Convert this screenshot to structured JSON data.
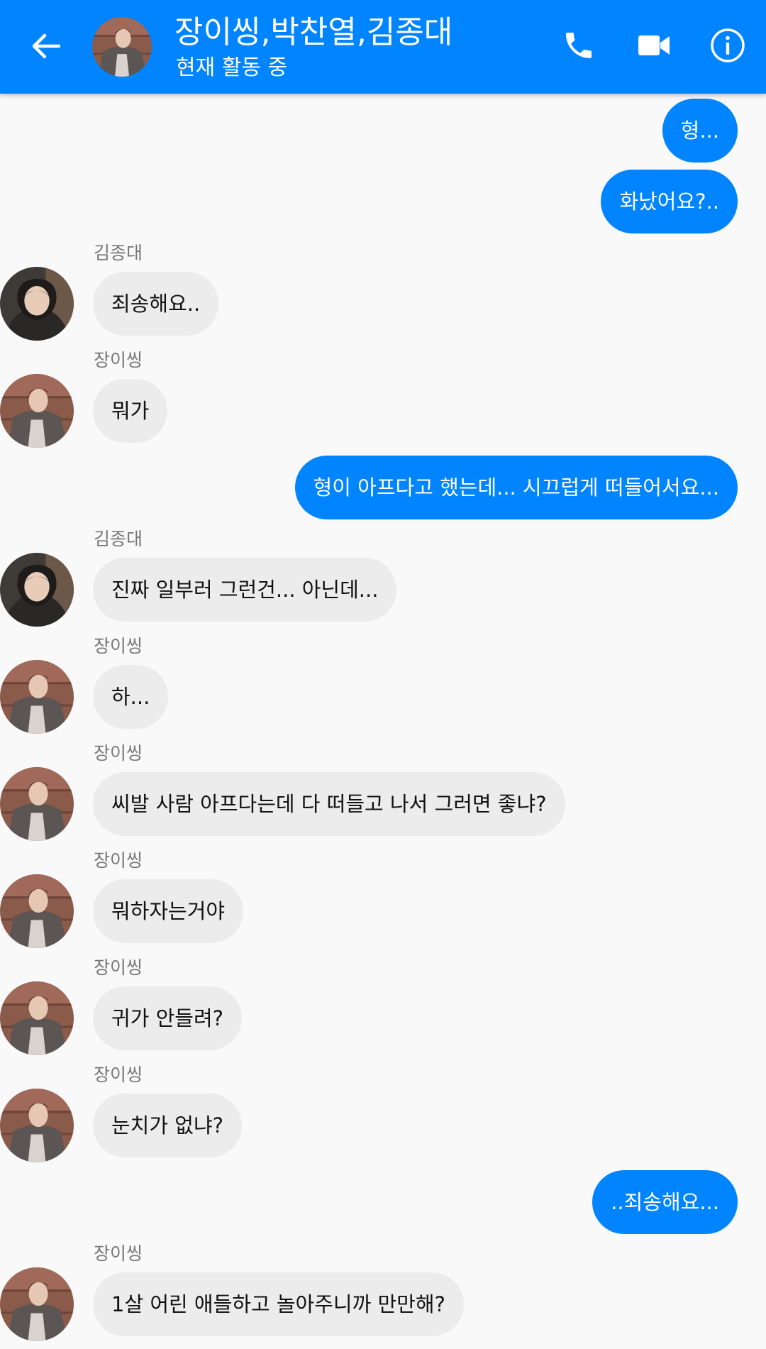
{
  "header": {
    "title": "장이씽,박찬열,김종대",
    "status": "현재 활동 중",
    "accent_color": "#0084ff",
    "icons": {
      "back": "arrow-left-icon",
      "call": "phone-icon",
      "video": "video-camera-icon",
      "info": "info-icon"
    }
  },
  "colors": {
    "outgoing_bubble": "#0084ff",
    "incoming_bubble": "#ececec",
    "background": "#f9f9fa"
  },
  "messages": [
    {
      "direction": "out",
      "text": "형..."
    },
    {
      "direction": "out",
      "text": "화났어요?.."
    },
    {
      "direction": "in",
      "sender": "김종대",
      "text": "죄송해요.."
    },
    {
      "direction": "in",
      "sender": "장이씽",
      "text": "뭐가"
    },
    {
      "direction": "out",
      "text": "형이 아프다고 했는데... 시끄럽게 떠들어서요..."
    },
    {
      "direction": "in",
      "sender": "김종대",
      "text": "진짜 일부러 그런건... 아닌데..."
    },
    {
      "direction": "in",
      "sender": "장이씽",
      "text": "하..."
    },
    {
      "direction": "in",
      "sender": "장이씽",
      "text": "씨발 사람 아프다는데 다 떠들고 나서 그러면 좋냐?"
    },
    {
      "direction": "in",
      "sender": "장이씽",
      "text": "뭐하자는거야"
    },
    {
      "direction": "in",
      "sender": "장이씽",
      "text": "귀가 안들려?"
    },
    {
      "direction": "in",
      "sender": "장이씽",
      "text": "눈치가 없냐?"
    },
    {
      "direction": "out",
      "text": "..죄송해요..."
    },
    {
      "direction": "in",
      "sender": "장이씽",
      "text": "1살 어린 애들하고 놀아주니까 만만해?"
    }
  ]
}
